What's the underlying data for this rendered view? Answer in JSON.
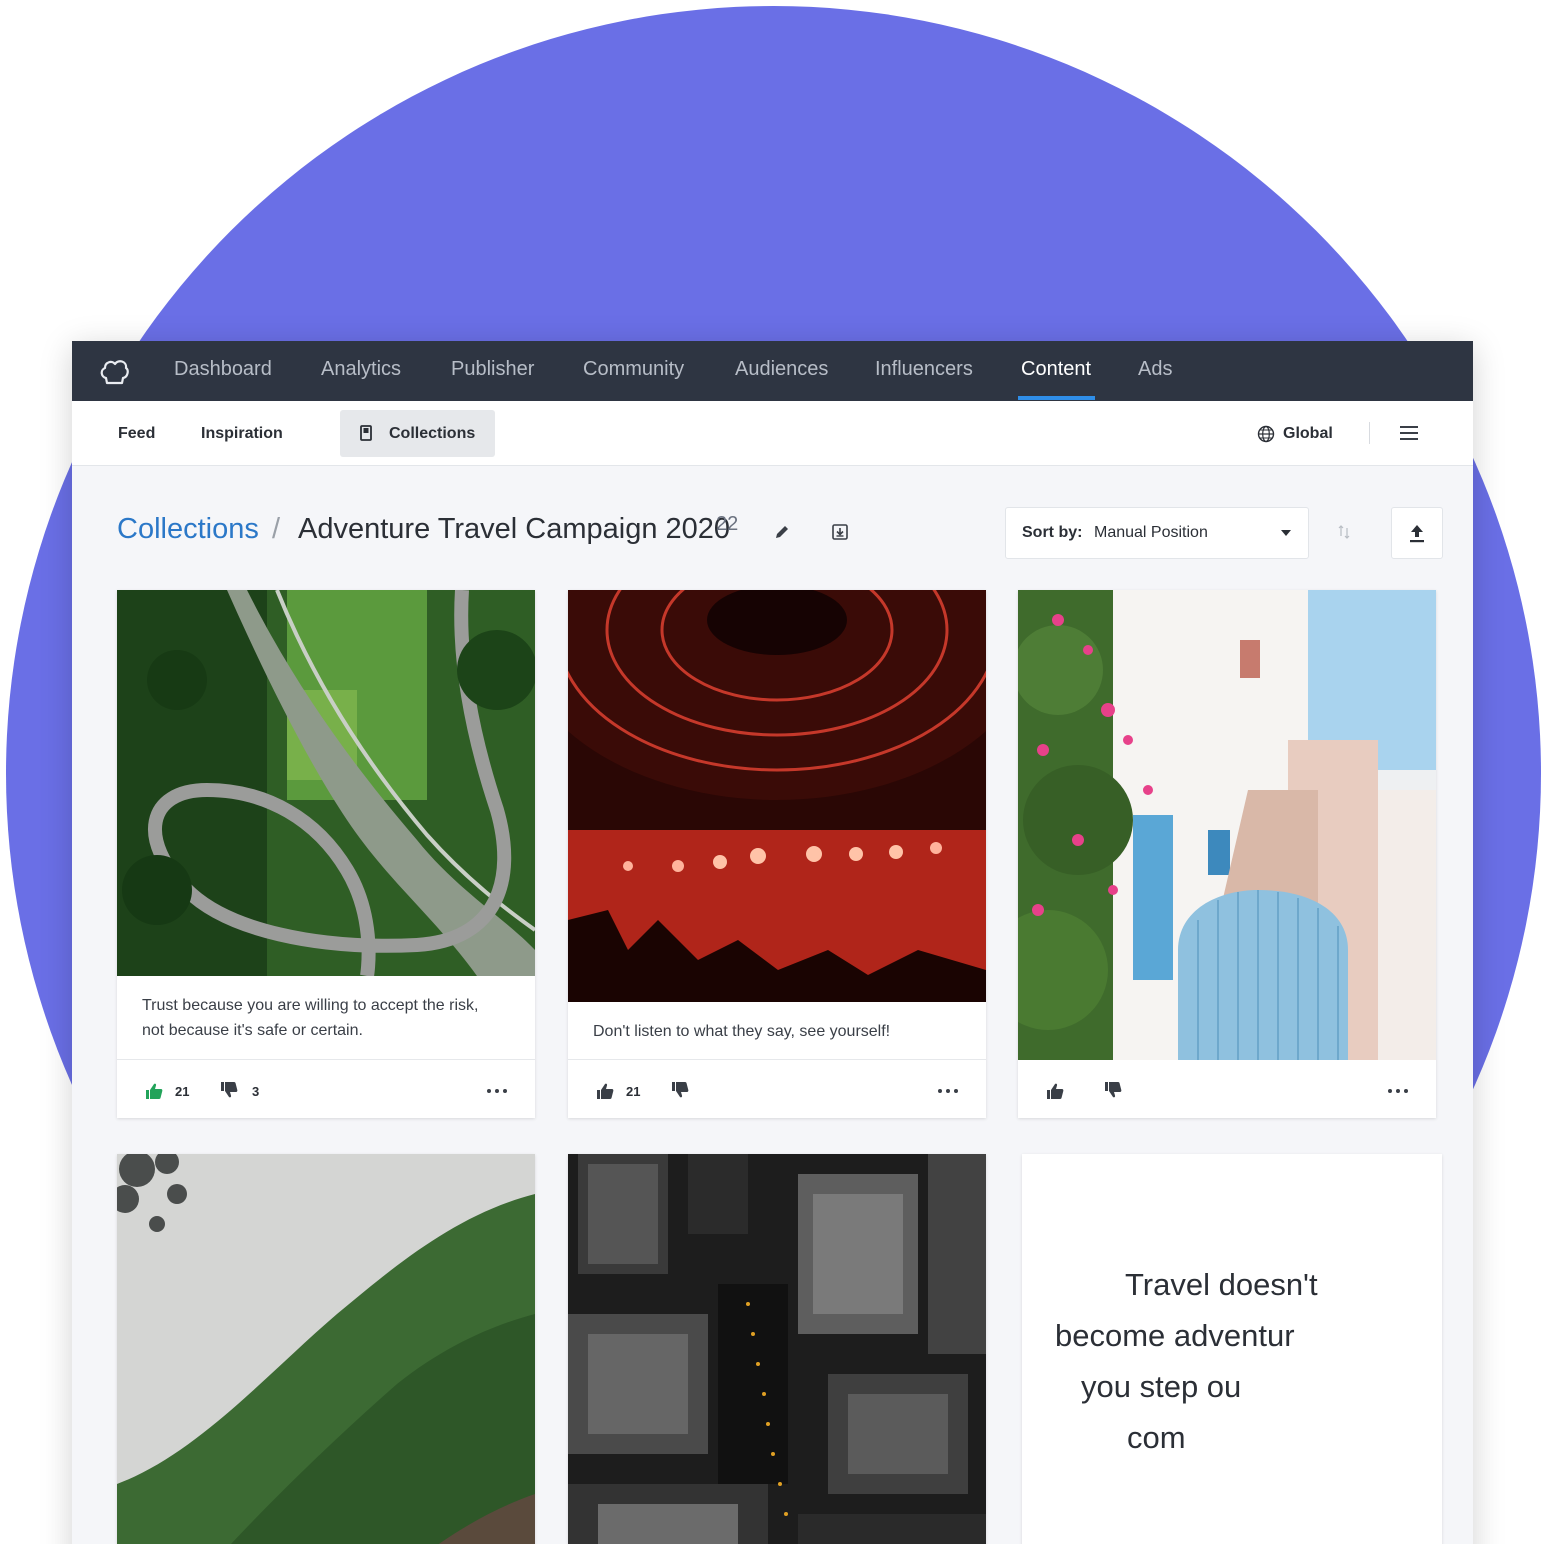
{
  "nav": {
    "items": [
      "Dashboard",
      "Analytics",
      "Publisher",
      "Community",
      "Audiences",
      "Influencers",
      "Content",
      "Ads"
    ],
    "active": "Content"
  },
  "subnav": {
    "feed": "Feed",
    "inspiration": "Inspiration",
    "collections": "Collections",
    "region": "Global"
  },
  "header": {
    "breadcrumb_root": "Collections",
    "separator": "/",
    "title": "Adventure Travel Campaign 2020",
    "count": "22",
    "sort_prefix": "Sort by:",
    "sort_value": "Manual Position"
  },
  "cards": [
    {
      "caption": "Trust because you are willing to accept the risk, not because it's safe or certain.",
      "likes": "21",
      "dislikes": "3"
    },
    {
      "caption": "Don't listen to what they say, see yourself!",
      "likes": "21",
      "dislikes": ""
    },
    {
      "caption": "",
      "likes": "",
      "dislikes": ""
    }
  ],
  "quote_card": {
    "lines": [
      "Travel doesn't",
      "become adventur",
      "you step ou",
      "com"
    ]
  },
  "colors": {
    "background_circle": "#6a6fe6",
    "nav_bg": "#2e3542",
    "accent": "#2f8ee8",
    "link": "#2b78c8",
    "like_active": "#22a35a"
  },
  "icons": [
    "chef-hat-logo-icon",
    "bookmark-icon",
    "globe-icon",
    "menu-icon",
    "pencil-icon",
    "download-icon",
    "caret-down-icon",
    "sort-direction-icon",
    "upload-icon",
    "thumbs-up-icon",
    "thumbs-down-icon",
    "more-icon"
  ]
}
